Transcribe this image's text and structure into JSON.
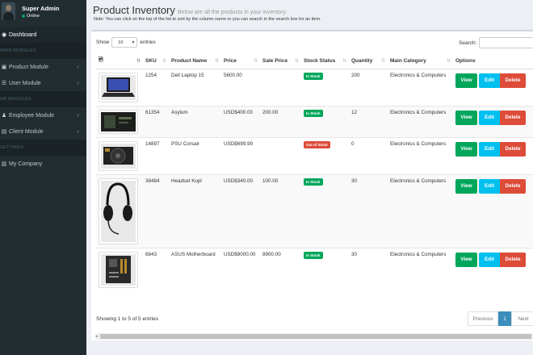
{
  "sidebar": {
    "user_name": "Super Admin",
    "user_status": "Online",
    "items": [
      {
        "type": "item",
        "label": "Dashboard",
        "icon": "dashboard-icon",
        "glyph": "◉",
        "active": true,
        "chevron": false
      },
      {
        "type": "header",
        "label": "MAIN MODULES"
      },
      {
        "type": "item",
        "label": "Product Module",
        "icon": "cart-icon",
        "glyph": "▣",
        "active": false,
        "chevron": true
      },
      {
        "type": "item",
        "label": "User Module",
        "icon": "list-icon",
        "glyph": "☰",
        "active": false,
        "chevron": true
      },
      {
        "type": "header",
        "label": "HR MODULES"
      },
      {
        "type": "item",
        "label": "Employee Module",
        "icon": "users-icon",
        "glyph": "♟",
        "active": false,
        "chevron": true
      },
      {
        "type": "item",
        "label": "Client Module",
        "icon": "briefcase-icon",
        "glyph": "▤",
        "active": false,
        "chevron": true
      },
      {
        "type": "header",
        "label": "SETTINGS"
      },
      {
        "type": "item",
        "label": "My Company",
        "icon": "building-icon",
        "glyph": "▥",
        "active": false,
        "chevron": false
      }
    ]
  },
  "page": {
    "title": "Product Inventory",
    "subtitle": "Below are all the products in your inventory.",
    "note": "Note: You can click on the top of the list to sort by the column name or you can search in the search box for an item."
  },
  "table_controls": {
    "show_label": "Show",
    "show_value": "10",
    "entries_label": "entries",
    "search_label": "Search:"
  },
  "columns": [
    "",
    "SKU",
    "Product Name",
    "Price",
    "Sale Price",
    "Stock Status",
    "Quantity",
    "Main Category",
    "Options"
  ],
  "rows": [
    {
      "sku": "1254",
      "name": "Dell Laptop 15",
      "price": "5600.00",
      "sale": "",
      "status": "In Stock",
      "in_stock": true,
      "qty": "200",
      "category": "Electronics & Computers",
      "img": "laptop"
    },
    {
      "sku": "61354",
      "name": "Asylum",
      "price": "USD$400.00",
      "sale": "200.00",
      "status": "In Stock",
      "in_stock": true,
      "qty": "12",
      "category": "Electronics & Computers",
      "img": "dvd"
    },
    {
      "sku": "14897",
      "name": "PSU Corsair",
      "price": "USD$699.99",
      "sale": "",
      "status": "Out of Stock",
      "in_stock": false,
      "qty": "0",
      "category": "Electronics & Computers",
      "img": "psu"
    },
    {
      "sku": "38484",
      "name": "Headset Kopl",
      "price": "USD$340.00",
      "sale": "100.00",
      "status": "In Stock",
      "in_stock": true,
      "qty": "30",
      "category": "Electronics & Computers",
      "img": "headset"
    },
    {
      "sku": "6843",
      "name": "ASUS Motherboard",
      "price": "USD$9000.00",
      "sale": "8900.00",
      "status": "In Stock",
      "in_stock": true,
      "qty": "30",
      "category": "Electronics & Computers",
      "img": "motherboard"
    }
  ],
  "row_buttons": {
    "view": "View",
    "edit": "Edit",
    "delete": "Delete"
  },
  "footer": {
    "info": "Showing 1 to 5 of 5 entries",
    "prev": "Previous",
    "current_page": "1",
    "next": "Next"
  },
  "colors": {
    "sidebar_bg": "#222d32",
    "primary": "#3c8dbc",
    "success": "#00a65a",
    "info": "#00c0ef",
    "danger": "#dd4b39"
  }
}
